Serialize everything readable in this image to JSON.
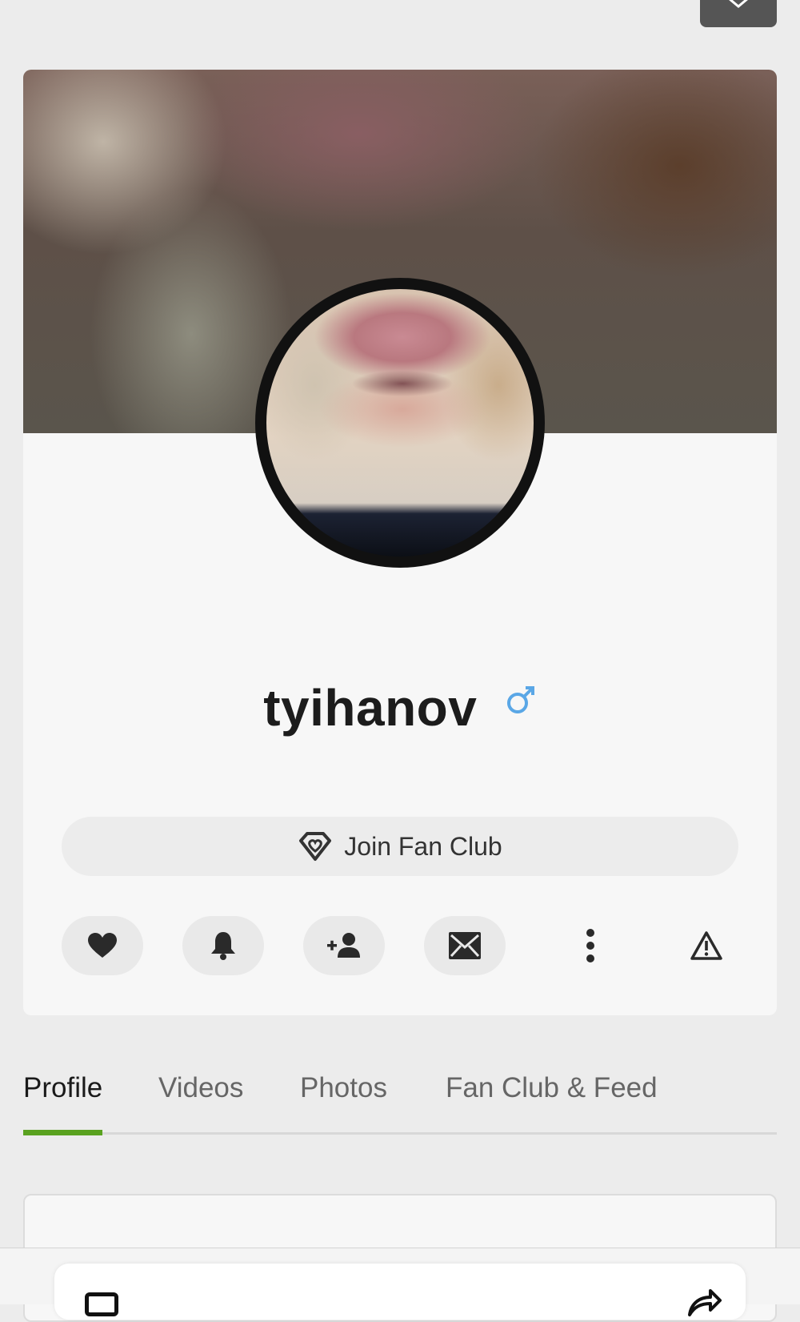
{
  "profile": {
    "username": "tyihanov",
    "gender_symbol": "♂",
    "gender_color": "#5aa7e6"
  },
  "fan_club": {
    "button_label": "Join Fan Club",
    "icon": "diamond-heart-icon"
  },
  "actions": [
    {
      "name": "like",
      "icon": "heart-icon"
    },
    {
      "name": "notify",
      "icon": "bell-icon"
    },
    {
      "name": "add-friend",
      "icon": "add-user-icon"
    },
    {
      "name": "message",
      "icon": "envelope-icon"
    },
    {
      "name": "more",
      "icon": "vertical-dots-icon"
    },
    {
      "name": "report",
      "icon": "warning-icon"
    }
  ],
  "tabs": [
    {
      "label": "Profile",
      "active": true
    },
    {
      "label": "Videos",
      "active": false
    },
    {
      "label": "Photos",
      "active": false
    },
    {
      "label": "Fan Club & Feed",
      "active": false
    }
  ],
  "colors": {
    "accent": "#5aa220",
    "card_bg": "#f7f7f7",
    "page_bg": "#ececec"
  }
}
